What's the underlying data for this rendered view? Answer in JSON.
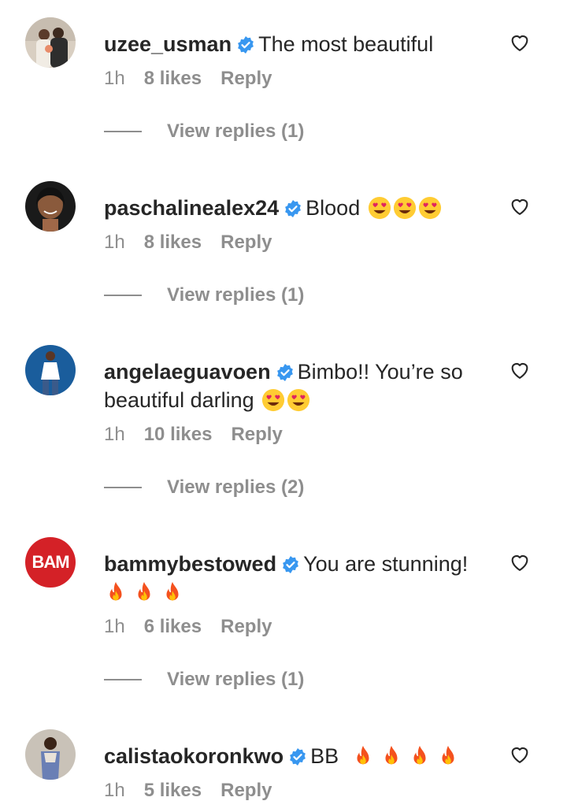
{
  "icons": {
    "verified": "verified-badge-icon",
    "heart": "heart-outline-icon",
    "emoji_heart_eyes": "heart-eyes-emoji",
    "emoji_fire": "fire-emoji"
  },
  "colors": {
    "verified": "#3897f0",
    "text": "#262626",
    "muted": "#8e8e8e",
    "bam_red": "#d42127"
  },
  "comments": [
    {
      "username": "uzee_usman",
      "text": "The most beautiful",
      "emojis": [],
      "time": "1h",
      "likes": "8 likes",
      "reply": "Reply",
      "view_replies": "View replies (1)"
    },
    {
      "username": "paschalinealex24",
      "text": "Blood",
      "emojis": [
        "heart-eyes",
        "heart-eyes",
        "heart-eyes"
      ],
      "time": "1h",
      "likes": "8 likes",
      "reply": "Reply",
      "view_replies": "View replies (1)"
    },
    {
      "username": "angelaeguavoen",
      "text": "Bimbo!! You’re so beautiful darling",
      "emojis": [
        "heart-eyes",
        "heart-eyes"
      ],
      "time": "1h",
      "likes": "10 likes",
      "reply": "Reply",
      "view_replies": "View replies (2)"
    },
    {
      "username": "bammybestowed",
      "text": "You are stunning!",
      "emojis": [
        "fire",
        "fire",
        "fire"
      ],
      "avatar_text": "BAM",
      "time": "1h",
      "likes": "6 likes",
      "reply": "Reply",
      "view_replies": "View replies (1)"
    },
    {
      "username": "calistaokoronkwo",
      "text": "BB",
      "emojis": [
        "fire",
        "fire",
        "fire",
        "fire"
      ],
      "time": "1h",
      "likes": "5 likes",
      "reply": "Reply"
    }
  ]
}
